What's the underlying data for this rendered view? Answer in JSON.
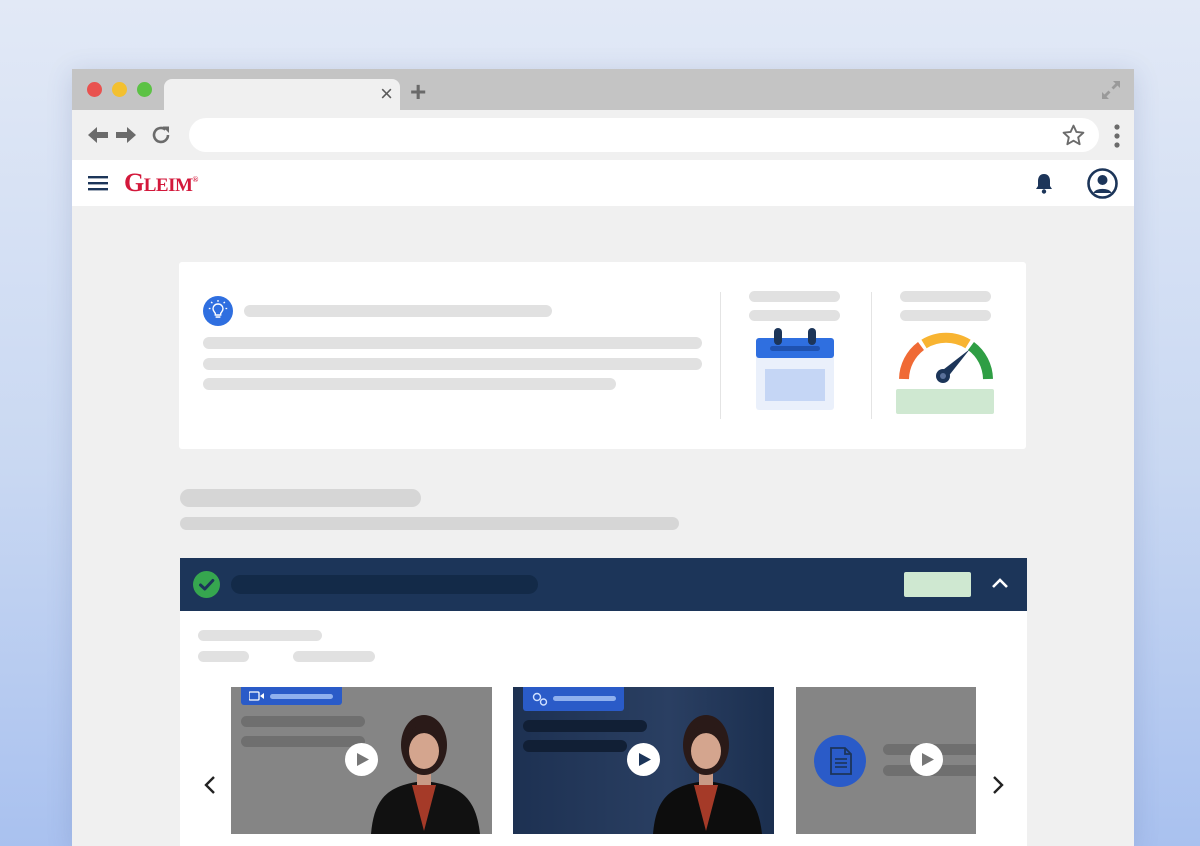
{
  "browser": {
    "traffic_lights": {
      "close_color": "#e9524f",
      "minimize_color": "#f3c030",
      "maximize_color": "#5cc245"
    },
    "tab_close_glyph": "×",
    "new_tab_glyph": "+",
    "url_value": "",
    "icons": [
      "back-arrow-icon",
      "forward-arrow-icon",
      "reload-icon",
      "star-icon",
      "more-vertical-icon",
      "expand-icon"
    ]
  },
  "app": {
    "logo_initial": "G",
    "logo_rest": "LEIM",
    "logo_mark": "®",
    "brand_color": "#d3183b",
    "nav_color": "#1c3559",
    "icons": [
      "hamburger-menu-icon",
      "notification-bell-icon",
      "user-account-icon"
    ]
  },
  "summary_card": {
    "icons": [
      "lightbulb-icon",
      "calendar-icon",
      "speedometer-gauge-icon"
    ],
    "gauge_colors": [
      "#f06a35",
      "#f8b431",
      "#2f9e44"
    ]
  },
  "section": {
    "accordion_status": "completed",
    "accordion_icons": [
      "check-circle-icon",
      "chevron-up-icon"
    ],
    "badge_color": "#cfe8d1"
  },
  "carousel": {
    "icons": [
      "chevron-left-icon",
      "chevron-right-icon",
      "video-icon",
      "gears-icon",
      "document-icon",
      "play-icon"
    ],
    "items": [
      {
        "type": "video",
        "header_icon": "video-icon"
      },
      {
        "type": "video",
        "header_icon": "gears-icon"
      },
      {
        "type": "document",
        "header_icon": "document-icon"
      }
    ]
  }
}
